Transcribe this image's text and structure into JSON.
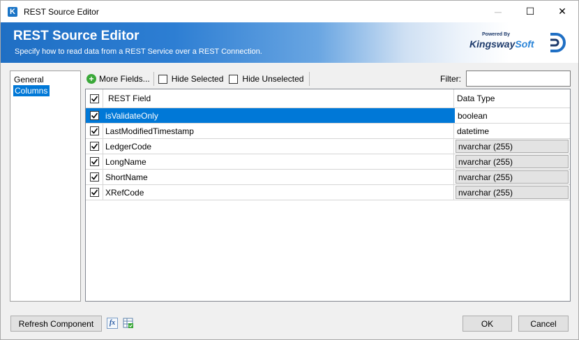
{
  "window": {
    "title": "REST Source Editor",
    "app_icon_letter": "K",
    "minimize_glyph": "─",
    "maximize_glyph": "☐",
    "close_glyph": "✕"
  },
  "banner": {
    "title": "REST Source Editor",
    "subtitle": "Specify how to read data from a REST Service over a REST Connection.",
    "logo_powered_by": "Powered By",
    "logo_brand_k": "K",
    "logo_brand_ingsway": "ingsway",
    "logo_brand_soft": "Soft"
  },
  "nav": {
    "items": [
      {
        "label": "General",
        "active": false
      },
      {
        "label": "Columns",
        "active": true
      }
    ]
  },
  "toolbar": {
    "more_fields_label": "More Fields...",
    "hide_selected_label": "Hide Selected",
    "hide_unselected_label": "Hide Unselected",
    "filter_label": "Filter:",
    "filter_value": ""
  },
  "grid": {
    "columns": {
      "field": "REST Field",
      "type": "Data Type"
    },
    "header_checked": true,
    "rows": [
      {
        "checked": true,
        "field": "isValidateOnly",
        "type": "boolean",
        "editable": false,
        "selected": true
      },
      {
        "checked": true,
        "field": "LastModifiedTimestamp",
        "type": "datetime",
        "editable": false,
        "selected": false
      },
      {
        "checked": true,
        "field": "LedgerCode",
        "type": "nvarchar (255)",
        "editable": true,
        "selected": false
      },
      {
        "checked": true,
        "field": "LongName",
        "type": "nvarchar (255)",
        "editable": true,
        "selected": false
      },
      {
        "checked": true,
        "field": "ShortName",
        "type": "nvarchar (255)",
        "editable": true,
        "selected": false
      },
      {
        "checked": true,
        "field": "XRefCode",
        "type": "nvarchar (255)",
        "editable": true,
        "selected": false
      }
    ]
  },
  "footer": {
    "refresh_label": "Refresh Component",
    "fx_label": "fx",
    "ok_label": "OK",
    "cancel_label": "Cancel"
  },
  "colors": {
    "selection": "#0078d7",
    "banner_start": "#1f6fc4",
    "add_icon": "#3aa839"
  },
  "icons": [
    "kingswaysoft-app-icon",
    "minimize-icon",
    "maximize-icon",
    "close-icon",
    "add-icon",
    "checkbox-icon",
    "fx-expression-icon",
    "grid-settings-icon"
  ]
}
